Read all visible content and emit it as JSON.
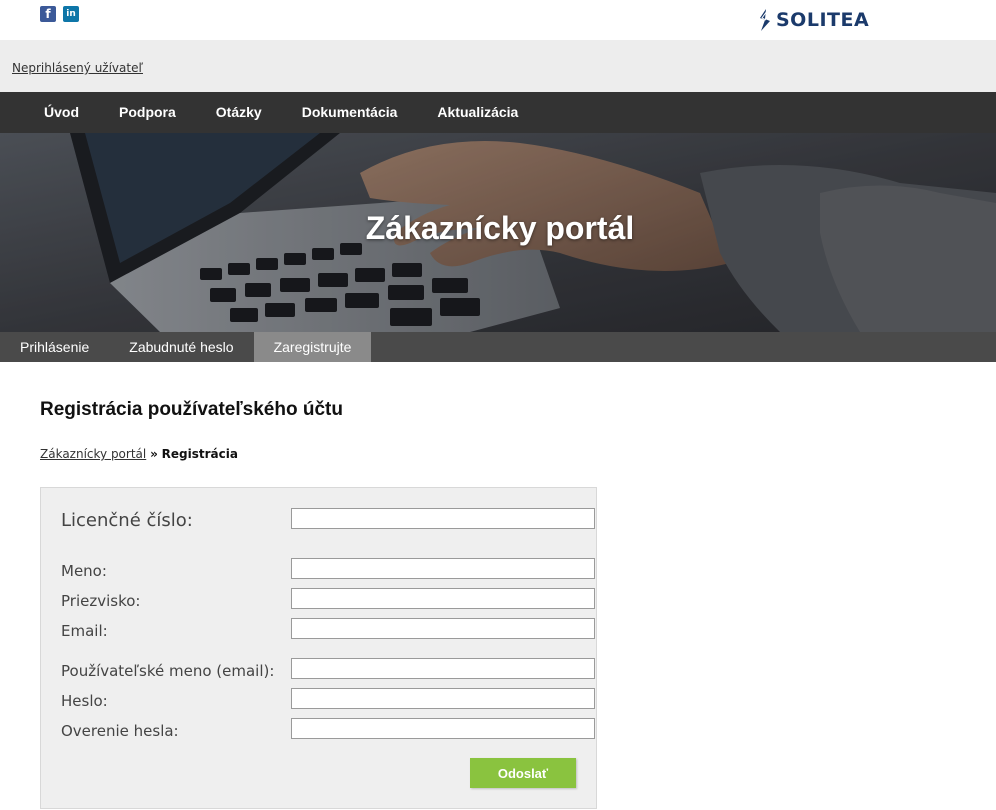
{
  "social": {
    "facebook_icon": "facebook-icon",
    "linkedin_icon": "linkedin-icon",
    "facebook_glyph": "f",
    "linkedin_glyph": "in"
  },
  "brand": {
    "logo_text": "SOLITEA",
    "color": "#1b3a6b"
  },
  "user": {
    "status_link": "Neprihlásený užívateľ"
  },
  "nav": {
    "items": [
      {
        "label": "Úvod"
      },
      {
        "label": "Podpora"
      },
      {
        "label": "Otázky"
      },
      {
        "label": "Dokumentácia"
      },
      {
        "label": "Aktualizácia"
      }
    ]
  },
  "hero": {
    "title": "Zákaznícky portál"
  },
  "subnav": {
    "items": [
      {
        "label": "Prihlásenie",
        "active": false
      },
      {
        "label": "Zabudnuté heslo",
        "active": false
      },
      {
        "label": "Zaregistrujte",
        "active": true
      }
    ]
  },
  "page": {
    "title": "Registrácia používateľského účtu",
    "breadcrumb": {
      "link": "Zákaznícky portál",
      "separator": "»",
      "current": "Registrácia"
    }
  },
  "form": {
    "license": {
      "label": "Licenčné číslo:",
      "value": ""
    },
    "first_name": {
      "label": "Meno:",
      "value": ""
    },
    "last_name": {
      "label": "Priezvisko:",
      "value": ""
    },
    "email": {
      "label": "Email:",
      "value": ""
    },
    "username": {
      "label": "Používateľské meno (email):",
      "value": ""
    },
    "password": {
      "label": "Heslo:",
      "value": ""
    },
    "password_confirm": {
      "label": "Overenie hesla:",
      "value": ""
    },
    "submit_label": "Odoslať"
  },
  "colors": {
    "nav_bg": "#333333",
    "subnav_bg": "#4a4a4a",
    "subnav_active": "#8a8a8a",
    "submit_bg": "#8ac33f",
    "form_bg": "#efefef"
  }
}
